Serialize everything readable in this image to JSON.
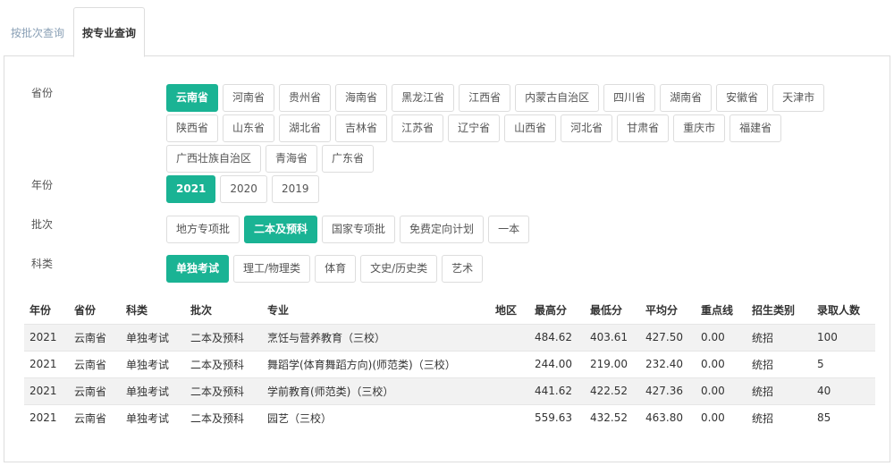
{
  "tabs": {
    "by_batch": "按批次查询",
    "by_major": "按专业查询"
  },
  "filters": {
    "province": {
      "label": "省份",
      "selected": "云南省",
      "options": [
        "云南省",
        "河南省",
        "贵州省",
        "海南省",
        "黑龙江省",
        "江西省",
        "内蒙古自治区",
        "四川省",
        "湖南省",
        "安徽省",
        "天津市",
        "陕西省",
        "山东省",
        "湖北省",
        "吉林省",
        "江苏省",
        "辽宁省",
        "山西省",
        "河北省",
        "甘肃省",
        "重庆市",
        "福建省",
        "广西壮族自治区",
        "青海省",
        "广东省"
      ]
    },
    "year": {
      "label": "年份",
      "selected": "2021",
      "options": [
        "2021",
        "2020",
        "2019"
      ]
    },
    "batch": {
      "label": "批次",
      "selected": "二本及预科",
      "options": [
        "地方专项批",
        "二本及预科",
        "国家专项批",
        "免费定向计划",
        "一本"
      ]
    },
    "subject": {
      "label": "科类",
      "selected": "单独考试",
      "options": [
        "单独考试",
        "理工/物理类",
        "体育",
        "文史/历史类",
        "艺术"
      ]
    }
  },
  "table": {
    "headers": [
      "年份",
      "省份",
      "科类",
      "批次",
      "专业",
      "地区",
      "最高分",
      "最低分",
      "平均分",
      "重点线",
      "招生类别",
      "录取人数"
    ],
    "rows": [
      [
        "2021",
        "云南省",
        "单独考试",
        "二本及预科",
        "烹饪与营养教育（三校）",
        "",
        "484.62",
        "403.61",
        "427.50",
        "0.00",
        "统招",
        "100"
      ],
      [
        "2021",
        "云南省",
        "单独考试",
        "二本及预科",
        "舞蹈学(体育舞蹈方向)(师范类)（三校）",
        "",
        "244.00",
        "219.00",
        "232.40",
        "0.00",
        "统招",
        "5"
      ],
      [
        "2021",
        "云南省",
        "单独考试",
        "二本及预科",
        "学前教育(师范类)（三校）",
        "",
        "441.62",
        "422.52",
        "427.36",
        "0.00",
        "统招",
        "40"
      ],
      [
        "2021",
        "云南省",
        "单独考试",
        "二本及预科",
        "园艺（三校）",
        "",
        "559.63",
        "432.52",
        "463.80",
        "0.00",
        "统招",
        "85"
      ]
    ]
  },
  "colors": {
    "accent": "#1ab394",
    "stripe": "#f2f2f2",
    "border": "#dddddd",
    "inactive_tab": "#8aa0b6"
  }
}
